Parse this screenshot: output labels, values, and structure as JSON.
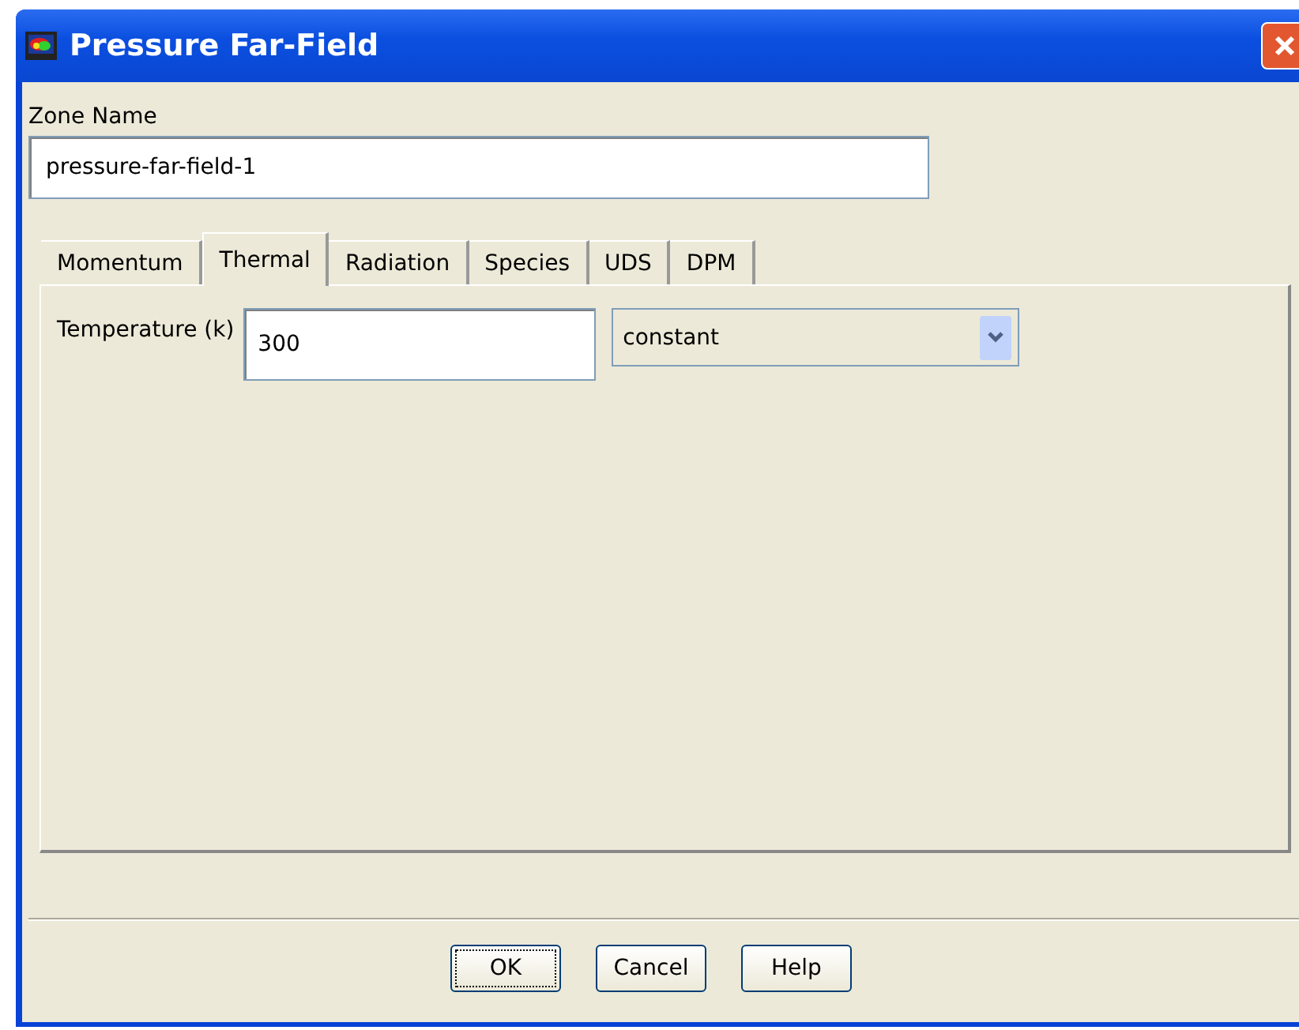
{
  "window": {
    "title": "Pressure Far-Field"
  },
  "zone_name": {
    "label": "Zone Name",
    "value": "pressure-far-field-1"
  },
  "tabs": [
    {
      "label": "Momentum",
      "selected": false
    },
    {
      "label": "Thermal",
      "selected": true
    },
    {
      "label": "Radiation",
      "selected": false
    },
    {
      "label": "Species",
      "selected": false
    },
    {
      "label": "UDS",
      "selected": false
    },
    {
      "label": "DPM",
      "selected": false
    }
  ],
  "temperature": {
    "label": "Temperature (k)",
    "value": "300",
    "method": "constant"
  },
  "buttons": [
    {
      "label": "OK",
      "focused": true
    },
    {
      "label": "Cancel",
      "focused": false
    },
    {
      "label": "Help",
      "focused": false
    }
  ]
}
